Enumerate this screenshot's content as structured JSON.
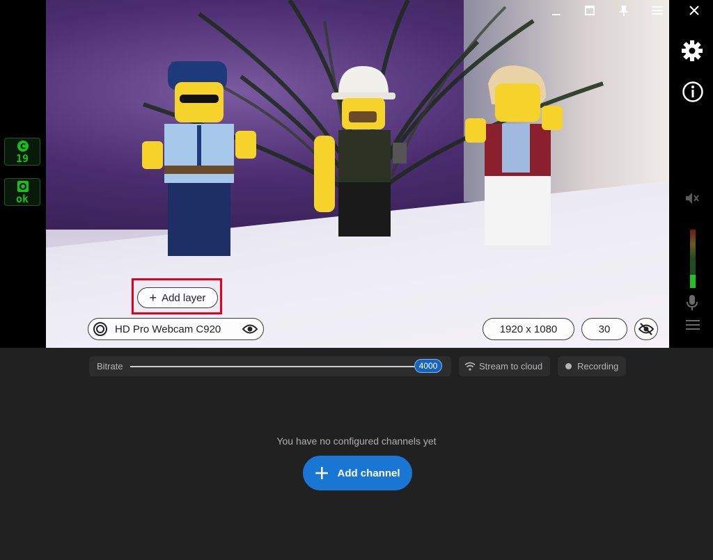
{
  "status": {
    "counter_value": "19",
    "health_value": "ok",
    "accent_color": "#16c016"
  },
  "preview": {
    "add_layer_label": "Add layer",
    "source_name": "HD Pro Webcam C920",
    "resolution": "1920 x 1080",
    "fps": "30"
  },
  "controls": {
    "bitrate_label": "Bitrate",
    "bitrate_value": "4000",
    "stream_label": "Stream to cloud",
    "recording_label": "Recording"
  },
  "channels": {
    "empty_message": "You have no configured channels yet",
    "add_label": "Add channel"
  },
  "icons": {
    "window": [
      "minimize-icon",
      "maximize-icon",
      "pin-icon",
      "menu-icon",
      "close-icon"
    ],
    "sidebar": [
      "gear-icon",
      "info-icon",
      "speaker-muted-icon",
      "microphone-icon",
      "hamburger-icon"
    ]
  },
  "colors": {
    "primary": "#1976d2",
    "highlight": "#e4001b"
  }
}
